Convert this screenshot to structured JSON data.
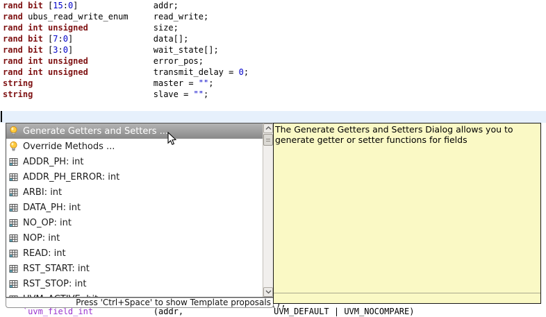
{
  "colors": {
    "keyword": "#7E1112",
    "number_literal": "#0000C8",
    "string_literal": "#0000C8",
    "macro": "#9A35CE",
    "current_line_bg": "#E6F0FC",
    "selection_top": "#B4B4B4",
    "selection_bottom": "#898989",
    "tooltip_bg": "#FAF9C5",
    "popup_border": "#4E4E4E"
  },
  "editor": {
    "code_lines": [
      {
        "tokens": [
          {
            "t": "rand bit",
            "c": "k"
          },
          {
            "t": " [",
            "c": "p"
          },
          {
            "t": "15",
            "c": "n"
          },
          {
            "t": ":",
            "c": "p"
          },
          {
            "t": "0",
            "c": "n"
          },
          {
            "t": "]",
            "c": "p"
          },
          {
            "t": "               ",
            "c": "p"
          },
          {
            "t": "addr;",
            "c": "p"
          }
        ]
      },
      {
        "tokens": [
          {
            "t": "rand",
            "c": "k"
          },
          {
            "t": " ubus_read_write_enum     ",
            "c": "p"
          },
          {
            "t": "read_write;",
            "c": "p"
          }
        ]
      },
      {
        "tokens": [
          {
            "t": "rand int unsigned",
            "c": "k"
          },
          {
            "t": "             ",
            "c": "p"
          },
          {
            "t": "size;",
            "c": "p"
          }
        ]
      },
      {
        "tokens": [
          {
            "t": "rand bit",
            "c": "k"
          },
          {
            "t": " [",
            "c": "p"
          },
          {
            "t": "7",
            "c": "n"
          },
          {
            "t": ":",
            "c": "p"
          },
          {
            "t": "0",
            "c": "n"
          },
          {
            "t": "]",
            "c": "p"
          },
          {
            "t": "                ",
            "c": "p"
          },
          {
            "t": "data[];",
            "c": "p"
          }
        ]
      },
      {
        "tokens": [
          {
            "t": "rand bit",
            "c": "k"
          },
          {
            "t": " [",
            "c": "p"
          },
          {
            "t": "3",
            "c": "n"
          },
          {
            "t": ":",
            "c": "p"
          },
          {
            "t": "0",
            "c": "n"
          },
          {
            "t": "]",
            "c": "p"
          },
          {
            "t": "                ",
            "c": "p"
          },
          {
            "t": "wait_state[];",
            "c": "p"
          }
        ]
      },
      {
        "tokens": [
          {
            "t": "rand int unsigned",
            "c": "k"
          },
          {
            "t": "             ",
            "c": "p"
          },
          {
            "t": "error_pos;",
            "c": "p"
          }
        ]
      },
      {
        "tokens": [
          {
            "t": "rand int unsigned",
            "c": "k"
          },
          {
            "t": "             ",
            "c": "p"
          },
          {
            "t": "transmit_delay = ",
            "c": "p"
          },
          {
            "t": "0",
            "c": "n"
          },
          {
            "t": ";",
            "c": "p"
          }
        ]
      },
      {
        "tokens": [
          {
            "t": "string",
            "c": "k"
          },
          {
            "t": "                        ",
            "c": "p"
          },
          {
            "t": "master = ",
            "c": "p"
          },
          {
            "t": "\"\"",
            "c": "s"
          },
          {
            "t": ";",
            "c": "p"
          }
        ]
      },
      {
        "tokens": [
          {
            "t": "string",
            "c": "k"
          },
          {
            "t": "                        ",
            "c": "p"
          },
          {
            "t": "slave = ",
            "c": "p"
          },
          {
            "t": "\"\"",
            "c": "s"
          },
          {
            "t": ";",
            "c": "p"
          }
        ]
      }
    ],
    "bottom_clipped_line": {
      "tokens": [
        {
          "t": "    ",
          "c": "p"
        },
        {
          "t": "`uvm_field_int",
          "c": "m"
        },
        {
          "t": "            ",
          "c": "p"
        },
        {
          "t": "(addr,",
          "c": "p"
        },
        {
          "t": "                  ",
          "c": "p"
        },
        {
          "t": "UVM_DEFAULT | UVM_NOCOMPARE)",
          "c": "p"
        }
      ]
    },
    "hidden_fragment": "();"
  },
  "popup": {
    "items": [
      {
        "icon": "bulb",
        "label": "Generate Getters and Setters ...",
        "selected": true
      },
      {
        "icon": "bulb",
        "label": "Override Methods ...",
        "selected": false
      },
      {
        "icon": "grid",
        "label": "ADDR_PH: int",
        "selected": false
      },
      {
        "icon": "grid",
        "label": "ADDR_PH_ERROR: int",
        "selected": false
      },
      {
        "icon": "grid",
        "label": "ARBI: int",
        "selected": false
      },
      {
        "icon": "grid",
        "label": "DATA_PH: int",
        "selected": false
      },
      {
        "icon": "grid",
        "label": "NO_OP: int",
        "selected": false
      },
      {
        "icon": "grid",
        "label": "NOP: int",
        "selected": false
      },
      {
        "icon": "grid",
        "label": "READ: int",
        "selected": false
      },
      {
        "icon": "grid",
        "label": "RST_START: int",
        "selected": false
      },
      {
        "icon": "grid",
        "label": "RST_STOP: int",
        "selected": false
      },
      {
        "icon": "grid",
        "label": "UVM_ACTIVE: bit",
        "selected": false
      }
    ],
    "status_text": "Press 'Ctrl+Space' to show Template proposals"
  },
  "tooltip": {
    "text": "The Generate Getters and Setters Dialog allows you to generate getter or setter functions for fields"
  }
}
